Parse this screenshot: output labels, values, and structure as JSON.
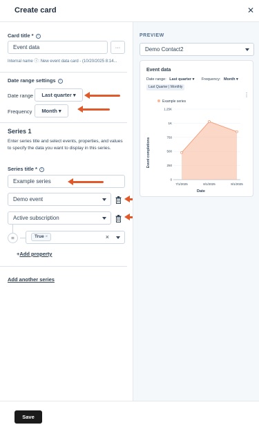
{
  "header": {
    "title": "Create card"
  },
  "form": {
    "card_title_label": "Card title *",
    "card_title_value": "Event data",
    "more_label": "···",
    "internal_name": "Internal name ⓘ: New event data card - (10/20/2025 8:14...",
    "date_settings_label": "Date range settings",
    "date_range_label": "Date range",
    "date_range_value": "Last quarter",
    "frequency_label": "Frequency",
    "frequency_value": "Month",
    "series_heading": "Series 1",
    "series_desc": "Enter series title and select events, properties, and values to specify the data you want to display in this series.",
    "series_title_label": "Series title *",
    "series_title_value": "Example series",
    "event_value": "Demo event",
    "property_value": "Active subscription",
    "operator_symbol": "=",
    "filter_chip": "True",
    "add_property": "Add property",
    "add_series": "Add another series"
  },
  "preview": {
    "label": "PREVIEW",
    "record_value": "Demo Contact2",
    "card_title": "Event data",
    "date_range_label": "Date range:",
    "date_range_value": "Last quarter",
    "frequency_label": "Frequency:",
    "frequency_value": "Month",
    "badge": "Last Quarter | Monthly",
    "more": "⋮"
  },
  "chart_data": {
    "type": "area",
    "x": [
      "7/1/2025",
      "8/1/2025",
      "9/1/2025"
    ],
    "series": [
      {
        "name": "Example series",
        "values": [
          480,
          1030,
          850
        ]
      }
    ],
    "xlabel": "Date",
    "ylabel": "Event completions",
    "yticks": [
      "0",
      "250",
      "500",
      "750",
      "1K",
      "1.25K"
    ],
    "ylim": [
      0,
      1250
    ],
    "color": "#f8b79a"
  },
  "footer": {
    "save_label": "Save"
  },
  "colors": {
    "accent": "#e0592a",
    "dark_button": "#1b1b1b",
    "link": "#2e3f50"
  }
}
